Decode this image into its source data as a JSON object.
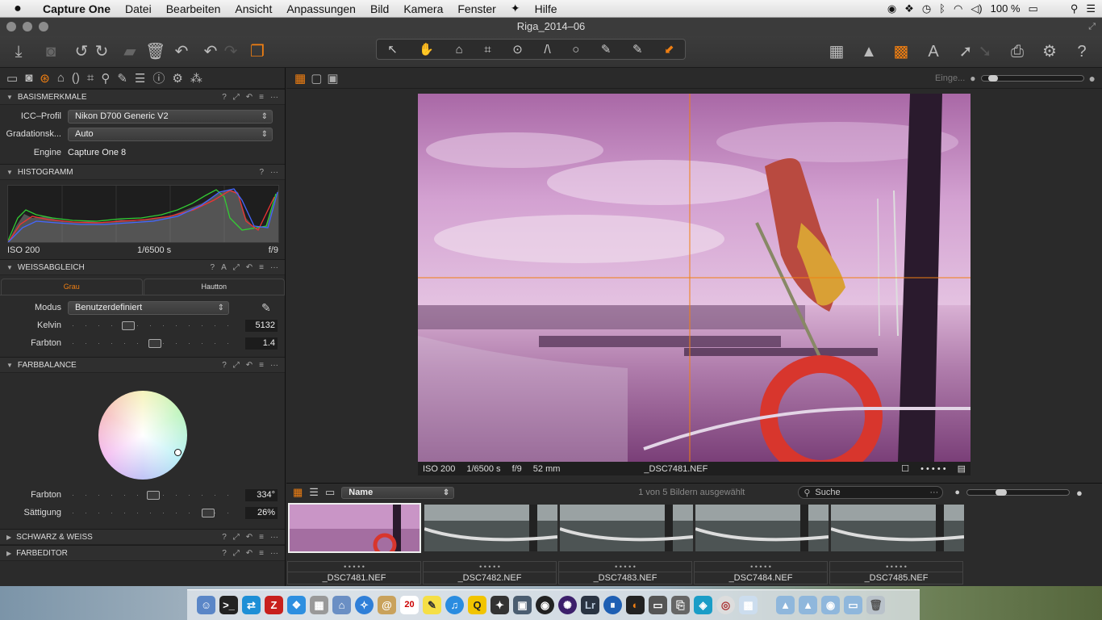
{
  "menubar": {
    "apple": "",
    "app": "Capture One",
    "items": [
      "Datei",
      "Bearbeiten",
      "Ansicht",
      "Anpassungen",
      "Bild",
      "Kamera",
      "Fenster",
      "Hilfe"
    ],
    "battery": "100 %"
  },
  "window": {
    "title": "Riga_2014–06"
  },
  "toolbar": {
    "left_icons": [
      "import-icon",
      "camera-icon",
      "rotate-left-icon",
      "rotate-right-icon",
      "move-folder-icon",
      "trash-icon",
      "undo-icon",
      "undo-alt-icon",
      "redo-icon",
      "variant-icon"
    ],
    "cursor_tools": [
      "↖",
      "✋",
      "⌂",
      "⌗",
      "⊙",
      "/\\",
      "○",
      "✎",
      "✎",
      "⬋"
    ],
    "right_icons": [
      "grid-icon",
      "warning-icon",
      "overlay-icon",
      "text-icon",
      "edit-icon",
      "edit-alt-icon",
      "print-icon",
      "settings-icon",
      "help-icon"
    ]
  },
  "viewer_header": {
    "label": "Einge..."
  },
  "basismerkmale": {
    "title": "BASISMERKMALE",
    "icc_label": "ICC–Profil",
    "icc_value": "Nikon D700 Generic V2",
    "grad_label": "Gradationsk...",
    "grad_value": "Auto",
    "engine_label": "Engine",
    "engine_value": "Capture One 8"
  },
  "histogramm": {
    "title": "HISTOGRAMM",
    "iso": "ISO 200",
    "shutter": "1/6500 s",
    "aperture": "f/9"
  },
  "weissabgleich": {
    "title": "WEISSABGLEICH",
    "tab1": "Grau",
    "tab2": "Hautton",
    "modus_label": "Modus",
    "modus_value": "Benutzerdefiniert",
    "kelvin_label": "Kelvin",
    "kelvin_value": "5132",
    "farbton_label": "Farbton",
    "farbton_value": "1.4",
    "kelvin_level": 0.33,
    "farbton_level": 0.51
  },
  "farbbalance": {
    "title": "FARBBALANCE",
    "farbton_label": "Farbton",
    "farbton_value": "334°",
    "saettigung_label": "Sättigung",
    "saettigung_value": "26%",
    "farbton_level": 0.5,
    "saettigung_level": 0.87
  },
  "collapsed": {
    "schwarz_weiss": "SCHWARZ & WEISS",
    "farbeditor": "FARBEDITOR"
  },
  "photo_info": {
    "iso": "ISO 200",
    "shutter": "1/6500 s",
    "aperture": "f/9",
    "focal": "52 mm",
    "filename": "_DSC7481.NEF",
    "stars": "• • • • •"
  },
  "browser": {
    "sort_value": "Name",
    "status": "1 von 5 Bildern ausgewählt",
    "search_placeholder": "Suche",
    "thumbs": [
      {
        "name": "_DSC7481.NEF",
        "stars": "• • • • •"
      },
      {
        "name": "_DSC7482.NEF",
        "stars": "• • • • •"
      },
      {
        "name": "_DSC7483.NEF",
        "stars": "• • • • •"
      },
      {
        "name": "_DSC7484.NEF",
        "stars": "• • • • •"
      },
      {
        "name": "_DSC7485.NEF",
        "stars": "• • • • •"
      }
    ]
  },
  "dock": {
    "calendar_day": "20"
  },
  "colors": {
    "accent": "#f07f12",
    "panel": "#2b2b2b",
    "photo_tint": "#c77fc2"
  }
}
